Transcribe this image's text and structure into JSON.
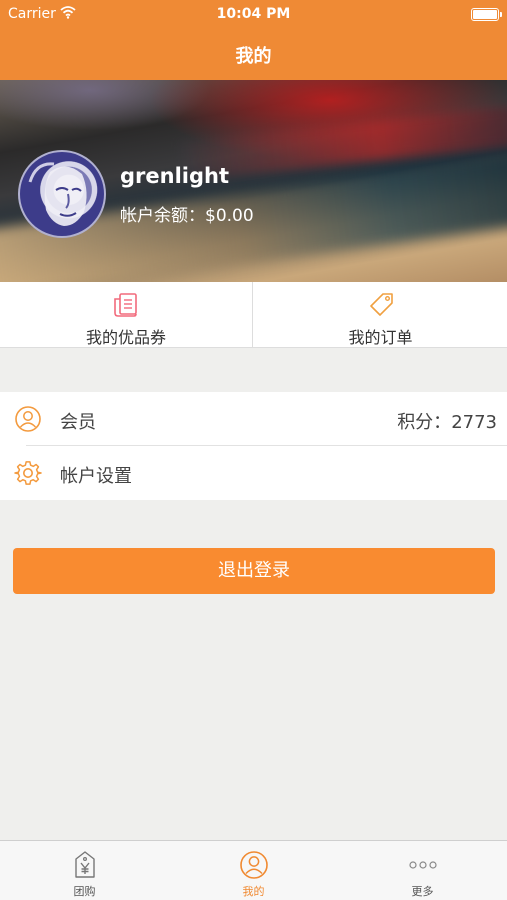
{
  "status_bar": {
    "carrier": "Carrier",
    "time": "10:04 PM"
  },
  "nav": {
    "title": "我的"
  },
  "profile": {
    "username": "grenlight",
    "balance_label": "帐户余额：",
    "balance_value": "$0.00"
  },
  "quick_actions": [
    {
      "label": "我的优品券",
      "icon": "coupon-icon"
    },
    {
      "label": "我的订单",
      "icon": "tag-icon"
    }
  ],
  "menu": {
    "member": {
      "label": "会员",
      "points_label": "积分：",
      "points_value": "2773",
      "icon": "user-circle-icon"
    },
    "settings": {
      "label": "帐户设置",
      "icon": "gear-icon"
    }
  },
  "logout": {
    "label": "退出登录"
  },
  "tabs": [
    {
      "label": "团购",
      "icon": "yen-tag-icon",
      "active": false
    },
    {
      "label": "我的",
      "icon": "user-circle-icon",
      "active": true
    },
    {
      "label": "更多",
      "icon": "more-dots-icon",
      "active": false
    }
  ],
  "colors": {
    "accent": "#ef8a35",
    "button": "#f98b30",
    "background": "#efefed"
  }
}
